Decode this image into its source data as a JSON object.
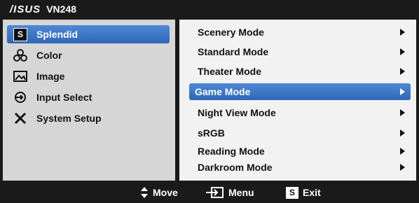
{
  "header": {
    "brand": "/ISUS",
    "model": "VN248"
  },
  "nav": {
    "items": [
      {
        "label": "Splendid",
        "icon": "splendid-s-icon",
        "selected": true
      },
      {
        "label": "Color",
        "icon": "color-icon",
        "selected": false
      },
      {
        "label": "Image",
        "icon": "image-icon",
        "selected": false
      },
      {
        "label": "Input Select",
        "icon": "input-select-icon",
        "selected": false
      },
      {
        "label": "System Setup",
        "icon": "system-setup-icon",
        "selected": false
      }
    ],
    "s_glyph": "S"
  },
  "modes": {
    "items": [
      {
        "label": "Scenery Mode",
        "selected": false
      },
      {
        "label": "Standard Mode",
        "selected": false
      },
      {
        "label": "Theater Mode",
        "selected": false
      },
      {
        "label": "Game Mode",
        "selected": true
      },
      {
        "label": "Night View Mode",
        "selected": false
      },
      {
        "label": "sRGB",
        "selected": false
      },
      {
        "label": "Reading Mode",
        "selected": false
      },
      {
        "label": "Darkroom Mode",
        "selected": false
      }
    ]
  },
  "footer": {
    "move_label": "Move",
    "menu_label": "Menu",
    "exit_label": "Exit",
    "exit_glyph": "S"
  },
  "colors": {
    "osd_bg": "#1a1a1a",
    "left_pane_bg": "#d6d6d6",
    "right_pane_bg": "#f2f2f2",
    "highlight": "#3b74c4",
    "text": "#111111"
  }
}
